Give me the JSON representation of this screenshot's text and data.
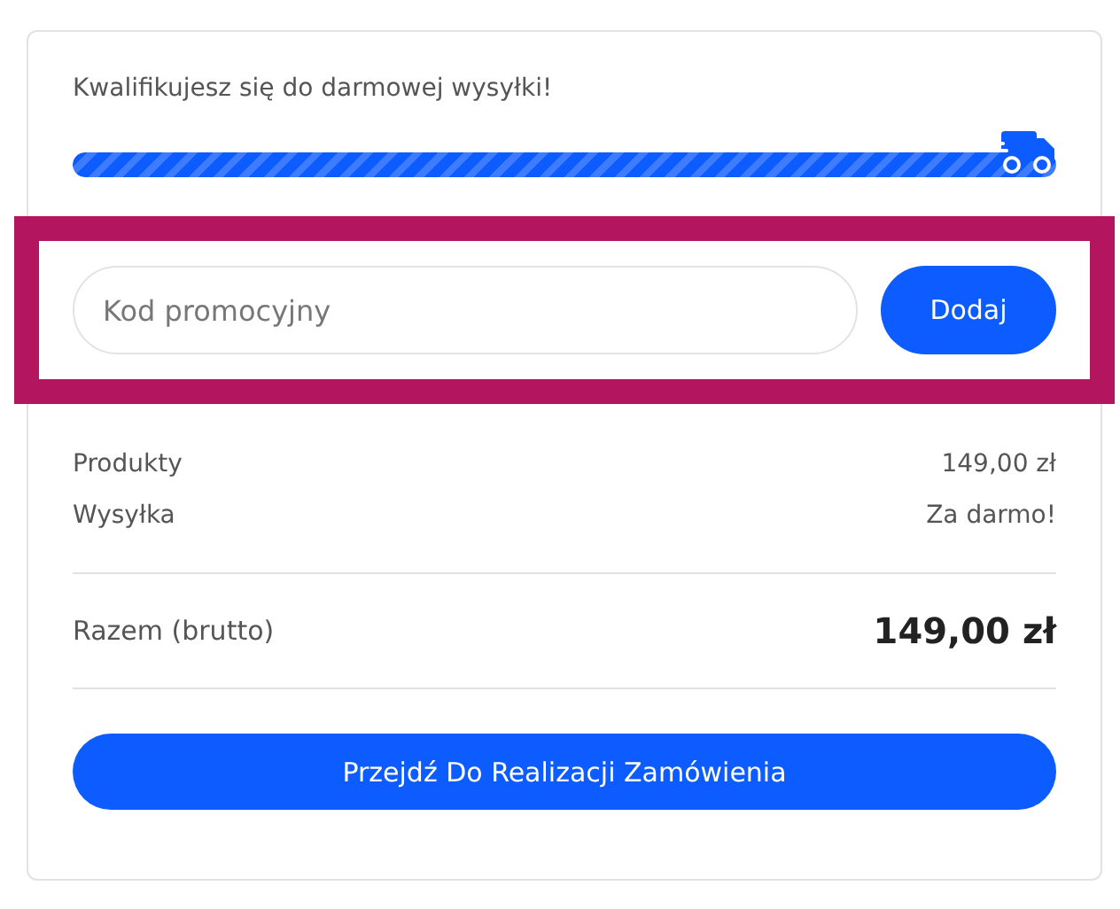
{
  "shipping": {
    "message": "Kwalifikujesz się do darmowej wysyłki!",
    "level": 1
  },
  "promo": {
    "placeholder": "Kod promocyjny",
    "button": "Dodaj"
  },
  "summary": {
    "rows": [
      {
        "label": "Produkty",
        "value": "149,00 zł"
      },
      {
        "label": "Wysyłka",
        "value": "Za darmo!"
      }
    ],
    "total": {
      "label": "Razem (brutto)",
      "value": "149,00 zł"
    }
  },
  "checkout_button": "Przejdź Do Realizacji Zamówienia"
}
